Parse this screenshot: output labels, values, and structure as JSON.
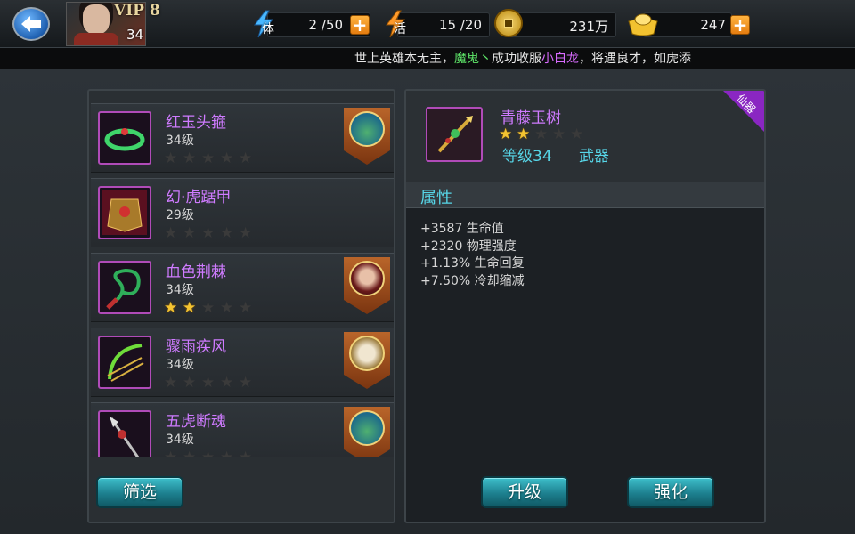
{
  "player": {
    "vip": "VIP 8",
    "level": "34"
  },
  "resources": {
    "stamina": {
      "label": "体",
      "value": "2 /50"
    },
    "energy": {
      "label": "活",
      "value": "15 /20"
    },
    "coins": {
      "value": "231万"
    },
    "gold": {
      "value": "247"
    },
    "plus": "+"
  },
  "ticker": {
    "part1": "世上英雄本无主，",
    "name1": "魔鬼丶",
    "part2": "成功收服",
    "name2": "小白龙",
    "part3": "，将遇良才，如虎添"
  },
  "equipment_list": [
    {
      "name": "红玉头箍",
      "level": "34级",
      "stars": 0,
      "icon": "jade-ring-icon",
      "has_hero": true,
      "hero": "dragon-hero-portrait"
    },
    {
      "name": "幻·虎踞甲",
      "level": "29级",
      "stars": 0,
      "icon": "tiger-armor-icon",
      "has_hero": false
    },
    {
      "name": "血色荆棘",
      "level": "34级",
      "stars": 2,
      "icon": "thorn-whip-icon",
      "has_hero": true,
      "hero": "female-hero-portrait"
    },
    {
      "name": "骤雨疾风",
      "level": "34级",
      "stars": 0,
      "icon": "green-bow-icon",
      "has_hero": true,
      "hero": "monk-hero-portrait"
    },
    {
      "name": "五虎断魂",
      "level": "34级",
      "stars": 0,
      "icon": "spear-icon",
      "has_hero": true,
      "hero": "dragon-hero-portrait"
    }
  ],
  "detail": {
    "name": "青藤玉树",
    "stars": 2,
    "level": "等级34",
    "type": "武器",
    "grade_badge": "仙器",
    "attr_title": "属性",
    "attributes": [
      "+3587 生命值",
      "+2320 物理强度",
      "+1.13% 生命回复",
      "+7.50% 冷却缩减"
    ]
  },
  "buttons": {
    "filter": "筛选",
    "upgrade": "升级",
    "enhance": "强化"
  },
  "colors": {
    "accent_purple": "#cf7bff",
    "accent_cyan": "#57d6e8",
    "button_teal": "#1d7f8e",
    "star_gold": "#f4c431"
  }
}
